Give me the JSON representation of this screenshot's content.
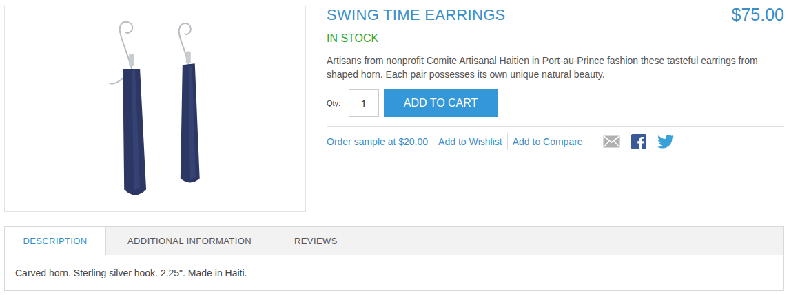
{
  "product": {
    "title": "SWING TIME EARRINGS",
    "price": "$75.00",
    "stock": "IN STOCK",
    "description": "Artisans from nonprofit Comite Artisanal Haitien in Port-au-Prince fashion these tasteful earrings from shaped horn. Each pair possesses its own unique natural beauty.",
    "qty_label": "Qty:",
    "qty": "1",
    "add_to_cart": "ADD TO CART"
  },
  "actions": [
    {
      "label": "Order sample at $20.00"
    },
    {
      "label": "Add to Wishlist"
    },
    {
      "label": "Add to Compare"
    }
  ],
  "tabs": [
    {
      "label": "DESCRIPTION",
      "selected": true
    },
    {
      "label": "ADDITIONAL INFORMATION",
      "selected": false
    },
    {
      "label": "REVIEWS",
      "selected": false
    }
  ],
  "tab_content": "Carved horn. Sterling silver hook. 2.25\". Made in Haiti."
}
